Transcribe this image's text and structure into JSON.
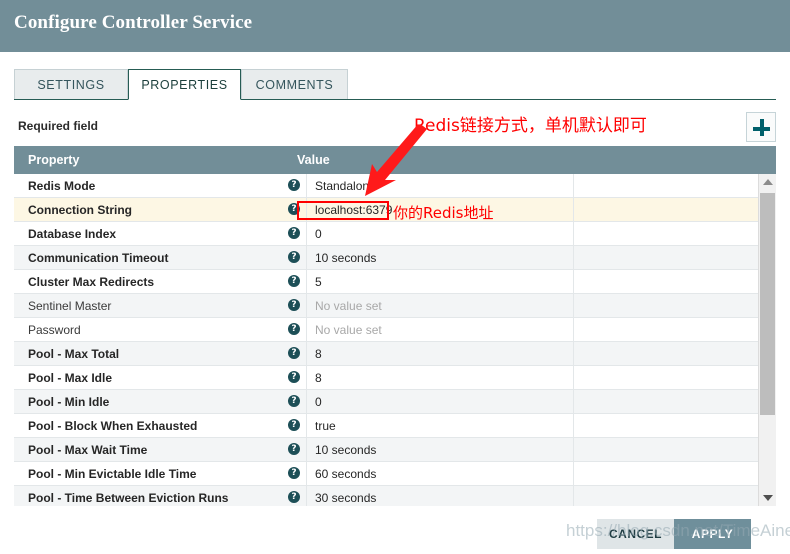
{
  "dialog": {
    "title": "Configure Controller Service",
    "header_color": "#728e98"
  },
  "tabs": [
    {
      "label": "SETTINGS",
      "active": false
    },
    {
      "label": "PROPERTIES",
      "active": true
    },
    {
      "label": "COMMENTS",
      "active": false
    }
  ],
  "toolbar": {
    "required_field_label": "Required field",
    "add_button_title": "+"
  },
  "table": {
    "columns": {
      "property": "Property",
      "value": "Value"
    },
    "help_glyph": "?",
    "rows": [
      {
        "name": "Redis Mode",
        "value": "Standalone",
        "required": true,
        "unset": false
      },
      {
        "name": "Connection String",
        "value": "localhost:6379",
        "required": true,
        "unset": false
      },
      {
        "name": "Database Index",
        "value": "0",
        "required": true,
        "unset": false
      },
      {
        "name": "Communication Timeout",
        "value": "10 seconds",
        "required": true,
        "unset": false
      },
      {
        "name": "Cluster Max Redirects",
        "value": "5",
        "required": true,
        "unset": false
      },
      {
        "name": "Sentinel Master",
        "value": "No value set",
        "required": false,
        "unset": true
      },
      {
        "name": "Password",
        "value": "No value set",
        "required": false,
        "unset": true
      },
      {
        "name": "Pool - Max Total",
        "value": "8",
        "required": true,
        "unset": false
      },
      {
        "name": "Pool - Max Idle",
        "value": "8",
        "required": true,
        "unset": false
      },
      {
        "name": "Pool - Min Idle",
        "value": "0",
        "required": true,
        "unset": false
      },
      {
        "name": "Pool - Block When Exhausted",
        "value": "true",
        "required": true,
        "unset": false
      },
      {
        "name": "Pool - Max Wait Time",
        "value": "10 seconds",
        "required": true,
        "unset": false
      },
      {
        "name": "Pool - Min Evictable Idle Time",
        "value": "60 seconds",
        "required": true,
        "unset": false
      },
      {
        "name": "Pool - Time Between Eviction Runs",
        "value": "30 seconds",
        "required": true,
        "unset": false
      }
    ],
    "highlighted_row_index": 1
  },
  "footer": {
    "cancel_label": "CANCEL",
    "apply_label": "APPLY"
  },
  "annotations": {
    "top_text": "Redis链接方式，单机默认即可",
    "value_text": "你的Redis地址",
    "color": "#ff0000"
  },
  "watermark": {
    "text": "https://blog.csdn.net/TimeAine"
  }
}
